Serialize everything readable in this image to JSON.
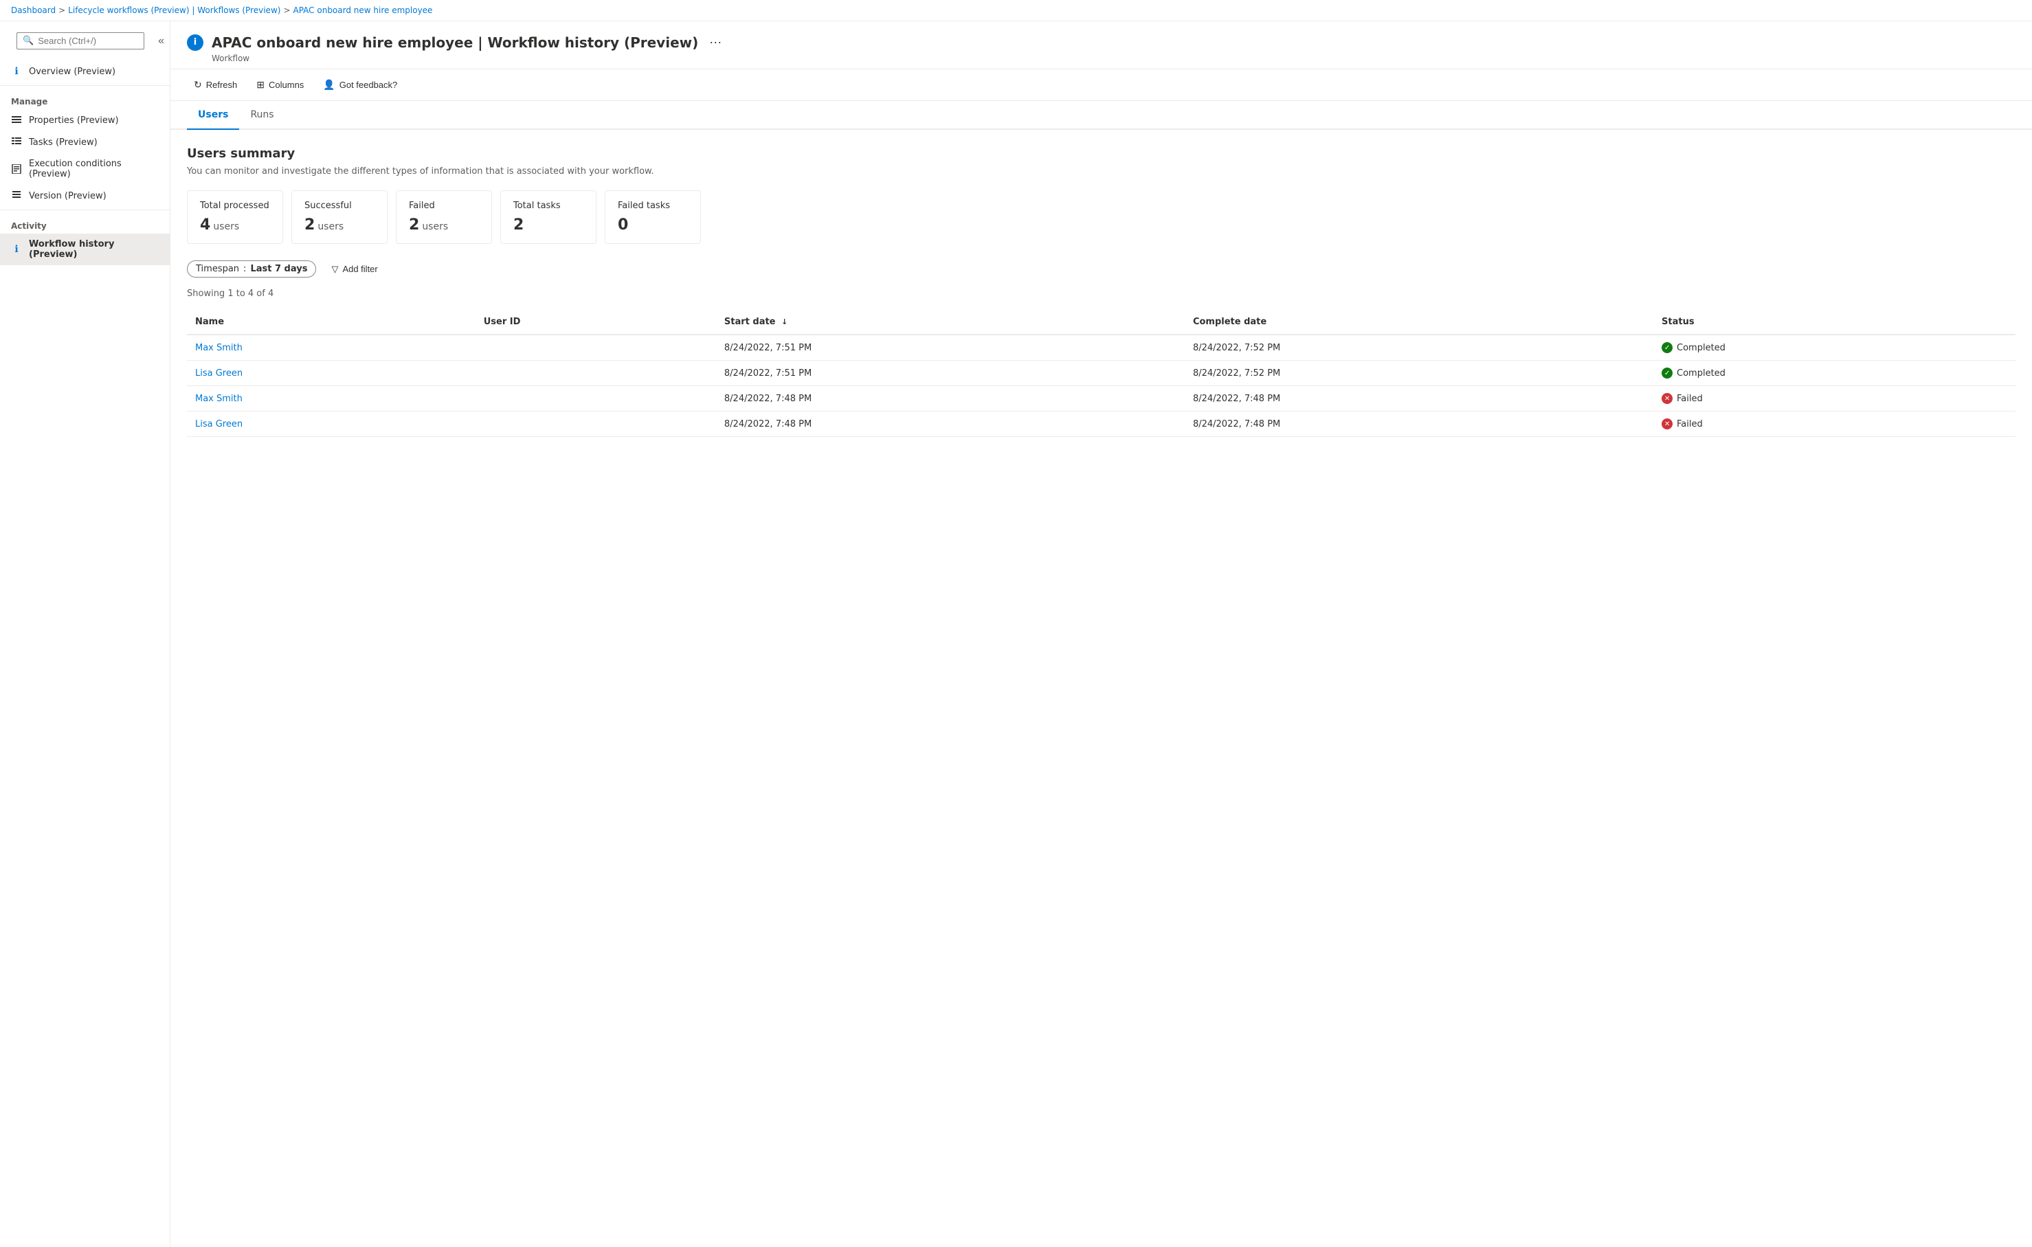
{
  "breadcrumb": {
    "items": [
      {
        "label": "Dashboard",
        "href": "#"
      },
      {
        "label": "Lifecycle workflows (Preview) | Workflows (Preview)",
        "href": "#"
      },
      {
        "label": "APAC onboard new hire employee",
        "href": "#"
      }
    ]
  },
  "page": {
    "title": "APAC onboard new hire employee | Workflow history (Preview)",
    "subtitle": "Workflow",
    "info_icon": "i",
    "ellipsis": "···"
  },
  "toolbar": {
    "refresh_label": "Refresh",
    "columns_label": "Columns",
    "feedback_label": "Got feedback?"
  },
  "tabs": [
    {
      "label": "Users",
      "active": true
    },
    {
      "label": "Runs",
      "active": false
    }
  ],
  "users_summary": {
    "title": "Users summary",
    "description": "You can monitor and investigate the different types of information that is associated with your workflow.",
    "cards": [
      {
        "id": "total-processed",
        "label": "Total processed",
        "value": "4",
        "unit": "users"
      },
      {
        "id": "successful",
        "label": "Successful",
        "value": "2",
        "unit": "users"
      },
      {
        "id": "failed",
        "label": "Failed",
        "value": "2",
        "unit": "users"
      },
      {
        "id": "total-tasks",
        "label": "Total tasks",
        "value": "2",
        "unit": ""
      },
      {
        "id": "failed-tasks",
        "label": "Failed tasks",
        "value": "0",
        "unit": ""
      }
    ]
  },
  "filters": {
    "timespan_label": "Timespan",
    "timespan_value": "Last 7 days",
    "add_filter_label": "Add filter"
  },
  "table": {
    "showing_text": "Showing 1 to 4 of 4",
    "columns": [
      {
        "id": "name",
        "label": "Name"
      },
      {
        "id": "user-id",
        "label": "User ID"
      },
      {
        "id": "start-date",
        "label": "Start date",
        "sort": "↓"
      },
      {
        "id": "complete-date",
        "label": "Complete date"
      },
      {
        "id": "status",
        "label": "Status"
      }
    ],
    "rows": [
      {
        "name": "Max Smith",
        "user_id": "",
        "start_date": "8/24/2022, 7:51 PM",
        "complete_date": "8/24/2022, 7:52 PM",
        "status": "Completed",
        "status_type": "completed"
      },
      {
        "name": "Lisa Green",
        "user_id": "",
        "start_date": "8/24/2022, 7:51 PM",
        "complete_date": "8/24/2022, 7:52 PM",
        "status": "Completed",
        "status_type": "completed"
      },
      {
        "name": "Max Smith",
        "user_id": "",
        "start_date": "8/24/2022, 7:48 PM",
        "complete_date": "8/24/2022, 7:48 PM",
        "status": "Failed",
        "status_type": "failed"
      },
      {
        "name": "Lisa Green",
        "user_id": "",
        "start_date": "8/24/2022, 7:48 PM",
        "complete_date": "8/24/2022, 7:48 PM",
        "status": "Failed",
        "status_type": "failed"
      }
    ]
  },
  "sidebar": {
    "search_placeholder": "Search (Ctrl+/)",
    "overview_label": "Overview (Preview)",
    "manage_label": "Manage",
    "manage_items": [
      {
        "id": "properties",
        "label": "Properties (Preview)",
        "icon": "bars"
      },
      {
        "id": "tasks",
        "label": "Tasks (Preview)",
        "icon": "list"
      },
      {
        "id": "execution-conditions",
        "label": "Execution conditions (Preview)",
        "icon": "doc"
      },
      {
        "id": "version",
        "label": "Version (Preview)",
        "icon": "stack"
      }
    ],
    "activity_label": "Activity",
    "activity_items": [
      {
        "id": "workflow-history",
        "label": "Workflow history (Preview)",
        "icon": "info",
        "active": true
      }
    ]
  }
}
